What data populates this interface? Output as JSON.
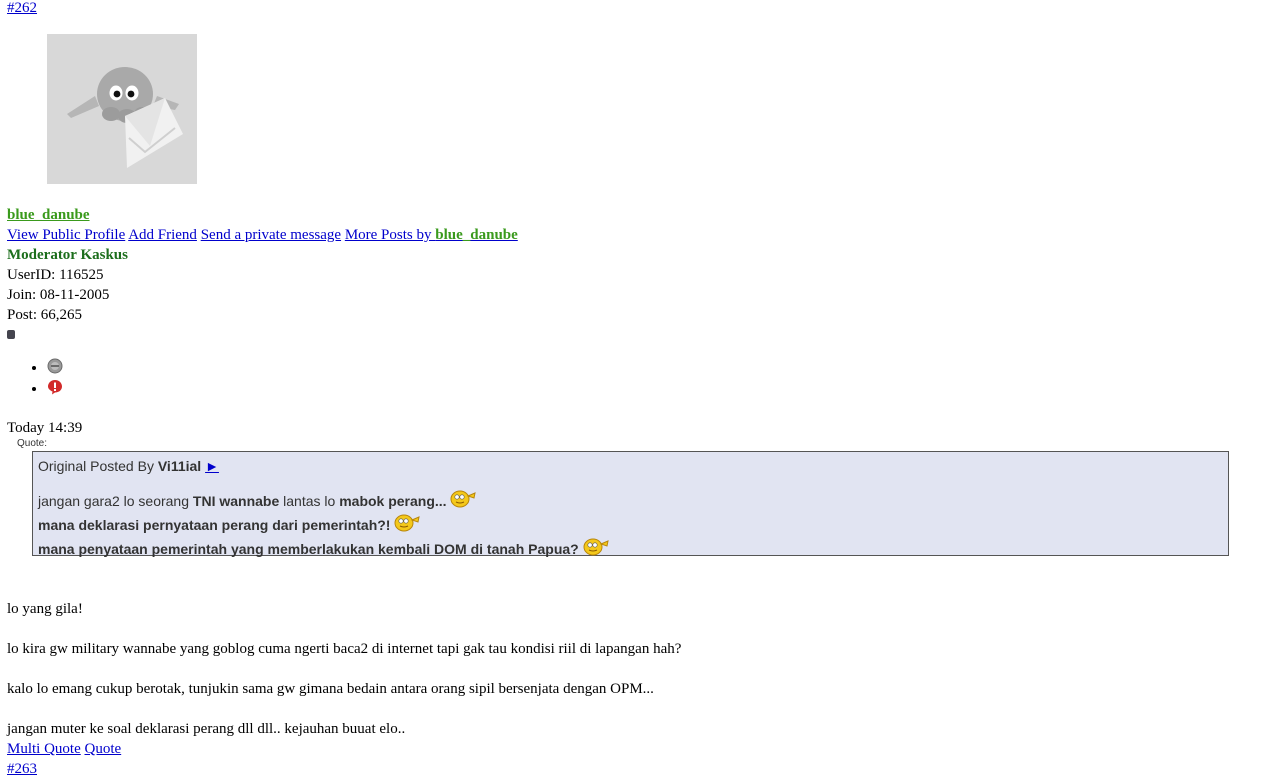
{
  "post": {
    "number": "#262",
    "username": "blue_danube",
    "links": {
      "view_profile": "View Public Profile",
      "add_friend": "Add Friend",
      "send_pm": "Send a private message",
      "more_posts_prefix": "More Posts by",
      "more_posts_user": "blue_danube"
    },
    "role": "Moderator Kaskus",
    "userid": "UserID: 116525",
    "join": "Join: 08-11-2005",
    "postcount": "Post: 66,265",
    "status_icons": [
      "offline-status-icon",
      "report-post-icon"
    ],
    "time": "Today 14:39"
  },
  "quote": {
    "label": "Quote:",
    "orig_prefix": "Original Posted By",
    "orig_user": "Vi11ial",
    "orig_link_glyph": "►",
    "line1_a": "jangan gara2 lo seorang ",
    "line1_b": "TNI wannabe",
    "line1_c": " lantas lo ",
    "line1_d": "mabok perang...",
    "line2": "mana deklarasi pernyataan perang dari pemerintah?!",
    "line3": "mana penyataan pemerintah yang memberlakukan kembali DOM di tanah Papua?"
  },
  "body": {
    "p1": "lo yang gila!",
    "p2": "lo kira gw military wannabe yang goblog cuma ngerti baca2 di internet tapi gak tau kondisi riil di lapangan hah?",
    "p3": "kalo lo emang cukup berotak, tunjukin sama gw gimana bedain antara orang sipil bersenjata dengan OPM...",
    "p4": "jangan muter ke soal deklarasi perang dll dll.. kejauhan buuat elo.."
  },
  "actions": {
    "multi_quote": "Multi Quote",
    "quote": "Quote"
  },
  "next_post_number": "#263",
  "colors": {
    "username_green": "#3a9a1c",
    "quote_bg": "#e1e4f2",
    "link_blue": "#0000cc"
  }
}
